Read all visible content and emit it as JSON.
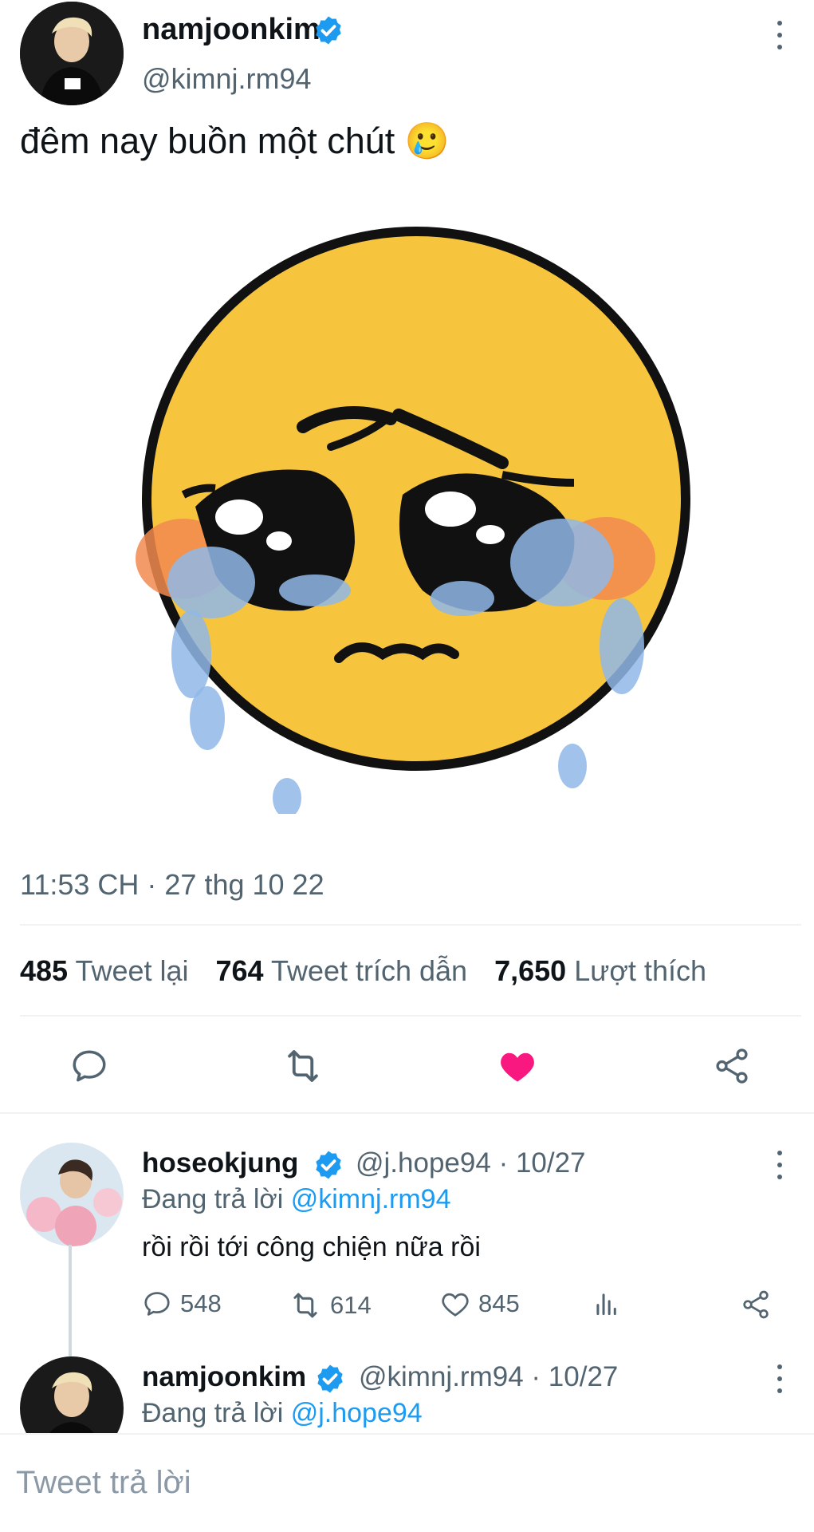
{
  "tweet": {
    "author_name": "namjoonkim",
    "author_handle": "@kimnj.rm94",
    "text": "đêm nay buồn một chút 🥲",
    "timestamp": "11:53 CH · 27 thg 10 22",
    "image_icon": "crying-pleading-face-sticker",
    "stats": {
      "retweets": "485",
      "retweets_label": "Tweet lại",
      "quotes": "764",
      "quotes_label": "Tweet trích dẫn",
      "likes": "7,650",
      "likes_label": "Lượt thích"
    },
    "liked": true,
    "colors": {
      "like": "#f91880",
      "verified": "#1d9bf0",
      "link": "#1d9bf0"
    }
  },
  "replies": [
    {
      "author_name": "hoseokjung",
      "author_handle": "@j.hope94",
      "date": "· 10/27",
      "replying_prefix": "Đang trả lời",
      "replying_to": "@kimnj.rm94",
      "text": "rồi rồi tới công chiện nữa rồi",
      "replies_count": "548",
      "retweets_count": "614",
      "likes_count": "845"
    },
    {
      "author_name": "namjoonkim",
      "author_handle": "@kimnj.rm94",
      "date": "· 10/27",
      "replying_prefix": "Đang trả lời",
      "replying_to": "@j.hope94"
    }
  ],
  "reply_input": {
    "placeholder": "Tweet trả lời"
  }
}
